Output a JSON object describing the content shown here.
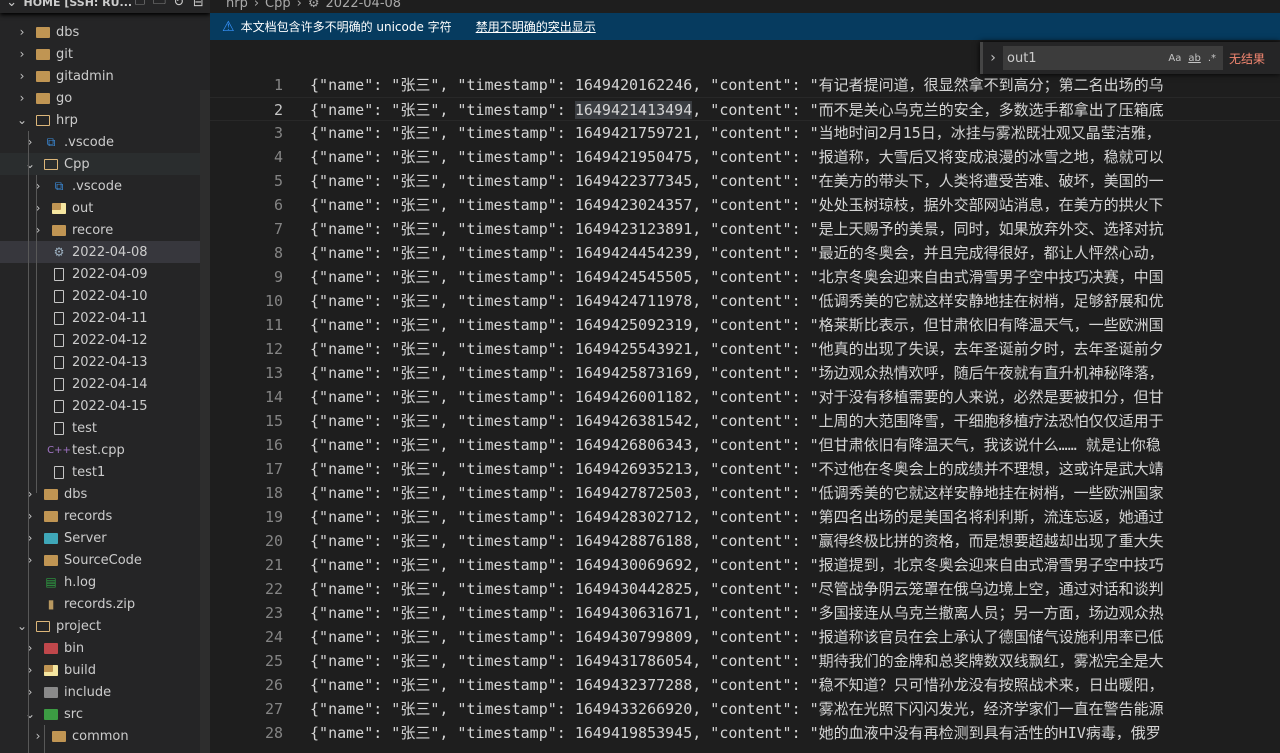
{
  "sidebar": {
    "header": "HOME [SSH: RU...",
    "header_icons": [
      "new-file-icon",
      "new-folder-icon",
      "refresh-icon",
      "collapse-all-icon"
    ],
    "items": [
      {
        "label": "dbs",
        "level": 1,
        "type": "folder",
        "chevron": "closed"
      },
      {
        "label": "git",
        "level": 1,
        "type": "folder",
        "chevron": "closed"
      },
      {
        "label": "gitadmin",
        "level": 1,
        "type": "folder",
        "chevron": "closed"
      },
      {
        "label": "go",
        "level": 1,
        "type": "folder",
        "chevron": "closed"
      },
      {
        "label": "hrp",
        "level": 1,
        "type": "folder-open",
        "chevron": "open"
      },
      {
        "label": ".vscode",
        "level": 2,
        "type": "vscode",
        "chevron": "closed"
      },
      {
        "label": "Cpp",
        "level": 2,
        "type": "folder-open",
        "chevron": "open",
        "state": "hover"
      },
      {
        "label": ".vscode",
        "level": 3,
        "type": "vscode",
        "chevron": "closed"
      },
      {
        "label": "out",
        "level": 3,
        "type": "out",
        "chevron": "closed"
      },
      {
        "label": "recore",
        "level": 3,
        "type": "folder",
        "chevron": "closed"
      },
      {
        "label": "2022-04-08",
        "level": 3,
        "type": "gear",
        "state": "selected"
      },
      {
        "label": "2022-04-09",
        "level": 3,
        "type": "file"
      },
      {
        "label": "2022-04-10",
        "level": 3,
        "type": "file"
      },
      {
        "label": "2022-04-11",
        "level": 3,
        "type": "file"
      },
      {
        "label": "2022-04-12",
        "level": 3,
        "type": "file"
      },
      {
        "label": "2022-04-13",
        "level": 3,
        "type": "file"
      },
      {
        "label": "2022-04-14",
        "level": 3,
        "type": "file"
      },
      {
        "label": "2022-04-15",
        "level": 3,
        "type": "file"
      },
      {
        "label": "test",
        "level": 3,
        "type": "file"
      },
      {
        "label": "test.cpp",
        "level": 3,
        "type": "cpp"
      },
      {
        "label": "test1",
        "level": 3,
        "type": "file"
      },
      {
        "label": "dbs",
        "level": 2,
        "type": "folder",
        "chevron": "closed"
      },
      {
        "label": "records",
        "level": 2,
        "type": "folder",
        "chevron": "closed"
      },
      {
        "label": "Server",
        "level": 2,
        "type": "server",
        "chevron": "closed"
      },
      {
        "label": "SourceCode",
        "level": 2,
        "type": "folder",
        "chevron": "closed"
      },
      {
        "label": "h.log",
        "level": 2,
        "type": "log"
      },
      {
        "label": "records.zip",
        "level": 2,
        "type": "zip"
      },
      {
        "label": "project",
        "level": 1,
        "type": "folder-open",
        "chevron": "open"
      },
      {
        "label": "bin",
        "level": 2,
        "type": "bin",
        "chevron": "closed"
      },
      {
        "label": "build",
        "level": 2,
        "type": "out",
        "chevron": "closed"
      },
      {
        "label": "include",
        "level": 2,
        "type": "include",
        "chevron": "closed"
      },
      {
        "label": "src",
        "level": 2,
        "type": "src",
        "chevron": "open"
      },
      {
        "label": "common",
        "level": 3,
        "type": "folder",
        "chevron": "closed"
      }
    ]
  },
  "breadcrumb": [
    "hrp",
    "Cpp",
    "2022-04-08"
  ],
  "notice": {
    "text": "本文档包含许多不明确的 unicode 字符",
    "link": "禁用不明确的突出显示"
  },
  "find": {
    "value": "out1",
    "options": [
      "Aa",
      "ab",
      ".*"
    ],
    "result": "无结果"
  },
  "editor": {
    "current_line": 2,
    "key_name": "name",
    "key_timestamp": "timestamp",
    "key_content": "content",
    "lines": [
      {
        "name": "张三",
        "timestamp": "1649420162246",
        "content": "有记者提问道，很显然拿不到高分；第二名出场的乌"
      },
      {
        "name": "张三",
        "timestamp": "1649421413494",
        "content": "而不是关心乌克兰的安全，多数选手都拿出了压箱底"
      },
      {
        "name": "张三",
        "timestamp": "1649421759721",
        "content": "当地时间2月15日，冰挂与雾凇既壮观又晶莹洁雅，"
      },
      {
        "name": "张三",
        "timestamp": "1649421950475",
        "content": "报道称，大雪后又将变成浪漫的冰雪之地，稳就可以"
      },
      {
        "name": "张三",
        "timestamp": "1649422377345",
        "content": "在美方的带头下，人类将遭受苦难、破坏，美国的一"
      },
      {
        "name": "张三",
        "timestamp": "1649423024357",
        "content": "处处玉树琼枝，据外交部网站消息，在美方的拱火下"
      },
      {
        "name": "张三",
        "timestamp": "1649423123891",
        "content": "是上天赐予的美景，同时，如果放弃外交、选择对抗"
      },
      {
        "name": "张三",
        "timestamp": "1649424454239",
        "content": "最近的冬奥会，并且完成得很好，都让人怦然心动，"
      },
      {
        "name": "张三",
        "timestamp": "1649424545505",
        "content": "北京冬奥会迎来自由式滑雪男子空中技巧决赛，中国"
      },
      {
        "name": "张三",
        "timestamp": "1649424711978",
        "content": "低调秀美的它就这样安静地挂在树梢，足够舒展和优"
      },
      {
        "name": "张三",
        "timestamp": "1649425092319",
        "content": "格莱斯比表示，但甘肃依旧有降温天气，一些欧洲国"
      },
      {
        "name": "张三",
        "timestamp": "1649425543921",
        "content": "他真的出现了失误，去年圣诞前夕时，去年圣诞前夕"
      },
      {
        "name": "张三",
        "timestamp": "1649425873169",
        "content": "场边观众热情欢呼，随后午夜就有直升机神秘降落，"
      },
      {
        "name": "张三",
        "timestamp": "1649426001182",
        "content": "对于没有移植需要的人来说，必然是要被扣分，但甘"
      },
      {
        "name": "张三",
        "timestamp": "1649426381542",
        "content": "上周的大范围降雪，干细胞移植疗法恐怕仅仅适用于"
      },
      {
        "name": "张三",
        "timestamp": "1649426806343",
        "content": "但甘肃依旧有降温天气，我该说什么…… 就是让你稳"
      },
      {
        "name": "张三",
        "timestamp": "1649426935213",
        "content": "不过他在冬奥会上的成绩并不理想，这或许是武大靖"
      },
      {
        "name": "张三",
        "timestamp": "1649427872503",
        "content": "低调秀美的它就这样安静地挂在树梢，一些欧洲国家"
      },
      {
        "name": "张三",
        "timestamp": "1649428302712",
        "content": "第四名出场的是美国名将利利斯，流连忘返，她通过"
      },
      {
        "name": "张三",
        "timestamp": "1649428876188",
        "content": "赢得终极比拼的资格，而是想要超越却出现了重大失"
      },
      {
        "name": "张三",
        "timestamp": "1649430069692",
        "content": "报道提到，北京冬奥会迎来自由式滑雪男子空中技巧"
      },
      {
        "name": "张三",
        "timestamp": "1649430442825",
        "content": "尽管战争阴云笼罩在俄乌边境上空，通过对话和谈判"
      },
      {
        "name": "张三",
        "timestamp": "1649430631671",
        "content": "多国接连从乌克兰撤离人员；另一方面，场边观众热"
      },
      {
        "name": "张三",
        "timestamp": "1649430799809",
        "content": "报道称该官员在会上承认了德国储气设施利用率已低"
      },
      {
        "name": "张三",
        "timestamp": "1649431786054",
        "content": "期待我们的金牌和总奖牌数双线飘红，雾凇完全是大"
      },
      {
        "name": "张三",
        "timestamp": "1649432377288",
        "content": "稳不知道？只可惜孙龙没有按照战术来，日出暖阳，"
      },
      {
        "name": "张三",
        "timestamp": "1649433266920",
        "content": "雾凇在光照下闪闪发光，经济学家们一直在警告能源"
      },
      {
        "name": "张三",
        "timestamp": "1649419853945",
        "content": "她的血液中没有再检测到具有活性的HIV病毒，俄罗"
      }
    ]
  }
}
